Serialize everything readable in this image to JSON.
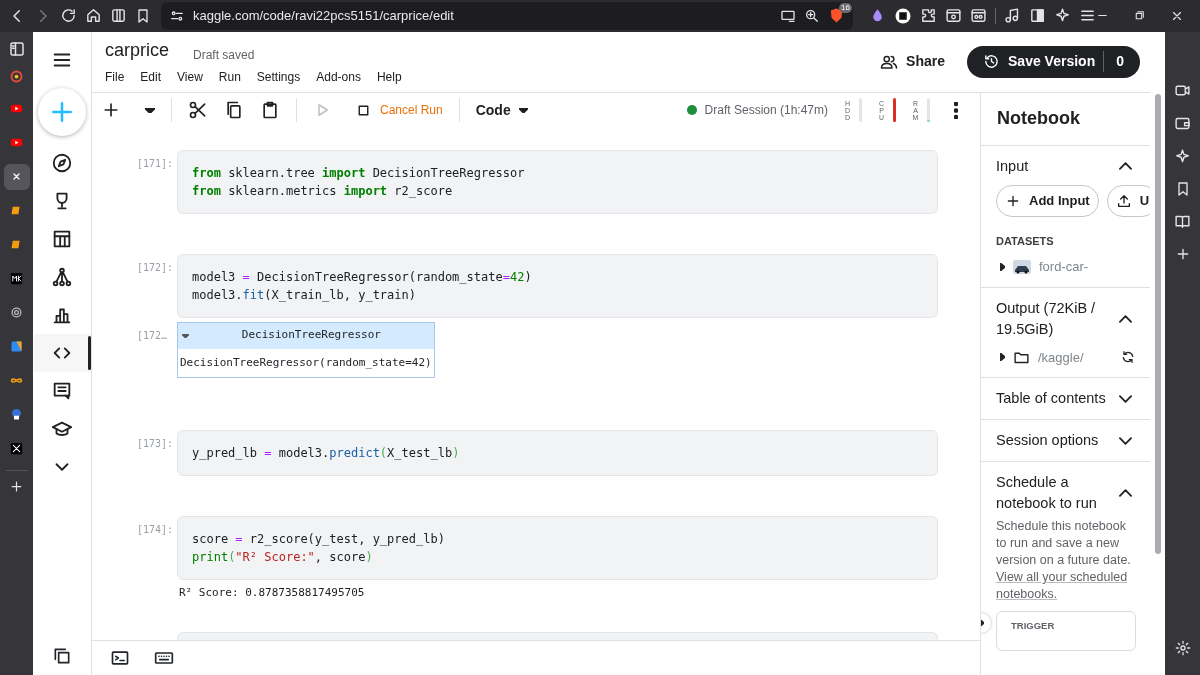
{
  "browser": {
    "url": "kaggle.com/code/ravi22pcs5151/carprice/edit",
    "shield_badge": "16",
    "sidebar_sites": [
      {
        "selected": false
      },
      {
        "selected": false
      },
      {
        "selected": false
      },
      {
        "selected": true
      },
      {
        "selected": false
      },
      {
        "selected": false
      },
      {
        "selected": false
      },
      {
        "selected": false
      },
      {
        "selected": false
      },
      {
        "selected": false
      },
      {
        "selected": false
      },
      {
        "selected": false
      }
    ]
  },
  "notebook": {
    "title": "carprice",
    "save_status": "Draft saved",
    "menu": [
      "File",
      "Edit",
      "View",
      "Run",
      "Settings",
      "Add-ons",
      "Help"
    ]
  },
  "header_actions": {
    "share": "Share",
    "save_version": "Save Version",
    "version_count": "0"
  },
  "nav_items": [
    {
      "selected": false
    },
    {
      "selected": false
    },
    {
      "selected": false
    },
    {
      "selected": false
    },
    {
      "selected": false
    },
    {
      "selected": true
    },
    {
      "selected": false
    },
    {
      "selected": false
    },
    {
      "selected": false
    }
  ],
  "toolbar": {
    "cancel_run": "Cancel Run",
    "cell_type": "Code",
    "session": "Draft Session (1h:47m)",
    "session_active": true,
    "meters": [
      {
        "label": "HDD",
        "level": 0.0
      },
      {
        "label": "CPU",
        "level": 1.0
      },
      {
        "label": "RAM",
        "level": 0.1
      }
    ]
  },
  "cells": [
    {
      "prompt": "[171]:",
      "lines": [
        [
          {
            "kind": "kw",
            "text": "from"
          },
          {
            "kind": "plain",
            "text": " sklearn.tree "
          },
          {
            "kind": "kw",
            "text": "import"
          },
          {
            "kind": "plain",
            "text": " DecisionTreeRegressor"
          }
        ],
        [
          {
            "kind": "kw",
            "text": "from"
          },
          {
            "kind": "plain",
            "text": " sklearn.metrics "
          },
          {
            "kind": "kw",
            "text": "import"
          },
          {
            "kind": "plain",
            "text": " r2_score"
          }
        ]
      ]
    },
    {
      "prompt": "[172]:",
      "lines": [
        [
          {
            "kind": "plain",
            "text": "model3 "
          },
          {
            "kind": "op",
            "text": "="
          },
          {
            "kind": "plain",
            "text": " DecisionTreeRegressor(random_state"
          },
          {
            "kind": "op",
            "text": "="
          },
          {
            "kind": "num",
            "text": "42"
          },
          {
            "kind": "plain",
            "text": ")"
          }
        ],
        [
          {
            "kind": "plain",
            "text": "model3."
          },
          {
            "kind": "fn",
            "text": "fit"
          },
          {
            "kind": "plain",
            "text": "(X_train_lb, y_train)"
          }
        ]
      ],
      "output": {
        "kind": "estimator",
        "prompt": "[172…",
        "title": "DecisionTreeRegressor",
        "body": "DecisionTreeRegressor(random_state=42)",
        "expanded": true
      }
    },
    {
      "prompt": "[173]:",
      "lines": [
        [
          {
            "kind": "plain",
            "text": "y_pred_lb "
          },
          {
            "kind": "op",
            "text": "="
          },
          {
            "kind": "plain",
            "text": " model3."
          },
          {
            "kind": "fn",
            "text": "predict"
          },
          {
            "kind": "bracket",
            "text": "("
          },
          {
            "kind": "plain",
            "text": "X_test_lb"
          },
          {
            "kind": "bracket",
            "text": ")"
          }
        ]
      ]
    },
    {
      "prompt": "[174]:",
      "lines": [
        [
          {
            "kind": "plain",
            "text": "score "
          },
          {
            "kind": "op",
            "text": "="
          },
          {
            "kind": "plain",
            "text": " r2_score(y_test, y_pred_lb)"
          }
        ],
        [
          {
            "kind": "builtin",
            "text": "print"
          },
          {
            "kind": "bracket",
            "text": "("
          },
          {
            "kind": "str",
            "text": "\"R² Score:\""
          },
          {
            "kind": "plain",
            "text": ", score"
          },
          {
            "kind": "bracket",
            "text": ")"
          }
        ]
      ],
      "output": {
        "kind": "stream",
        "text": "R² Score: 0.8787358817495705"
      }
    }
  ],
  "panel": {
    "title": "Notebook",
    "sections": [
      {
        "kind": "input",
        "title": "Input",
        "expanded": true,
        "buttons": [
          "Add Input",
          "U"
        ],
        "group_label": "DATASETS",
        "items": [
          {
            "name": "ford-car-",
            "expanded": false
          }
        ]
      },
      {
        "kind": "output",
        "title": "Output (72KiB / 19.5GiB)",
        "expanded": true,
        "items": [
          {
            "name": "/kaggle/",
            "expanded": false
          }
        ]
      },
      {
        "title": "Table of contents",
        "expanded": false
      },
      {
        "title": "Session options",
        "expanded": false
      },
      {
        "kind": "schedule",
        "title": "Schedule a notebook to run",
        "expanded": true,
        "text": "Schedule this notebook to run and save a new version on a future date.",
        "link": "View all your scheduled notebooks.",
        "field_label": "TRIGGER"
      }
    ]
  }
}
